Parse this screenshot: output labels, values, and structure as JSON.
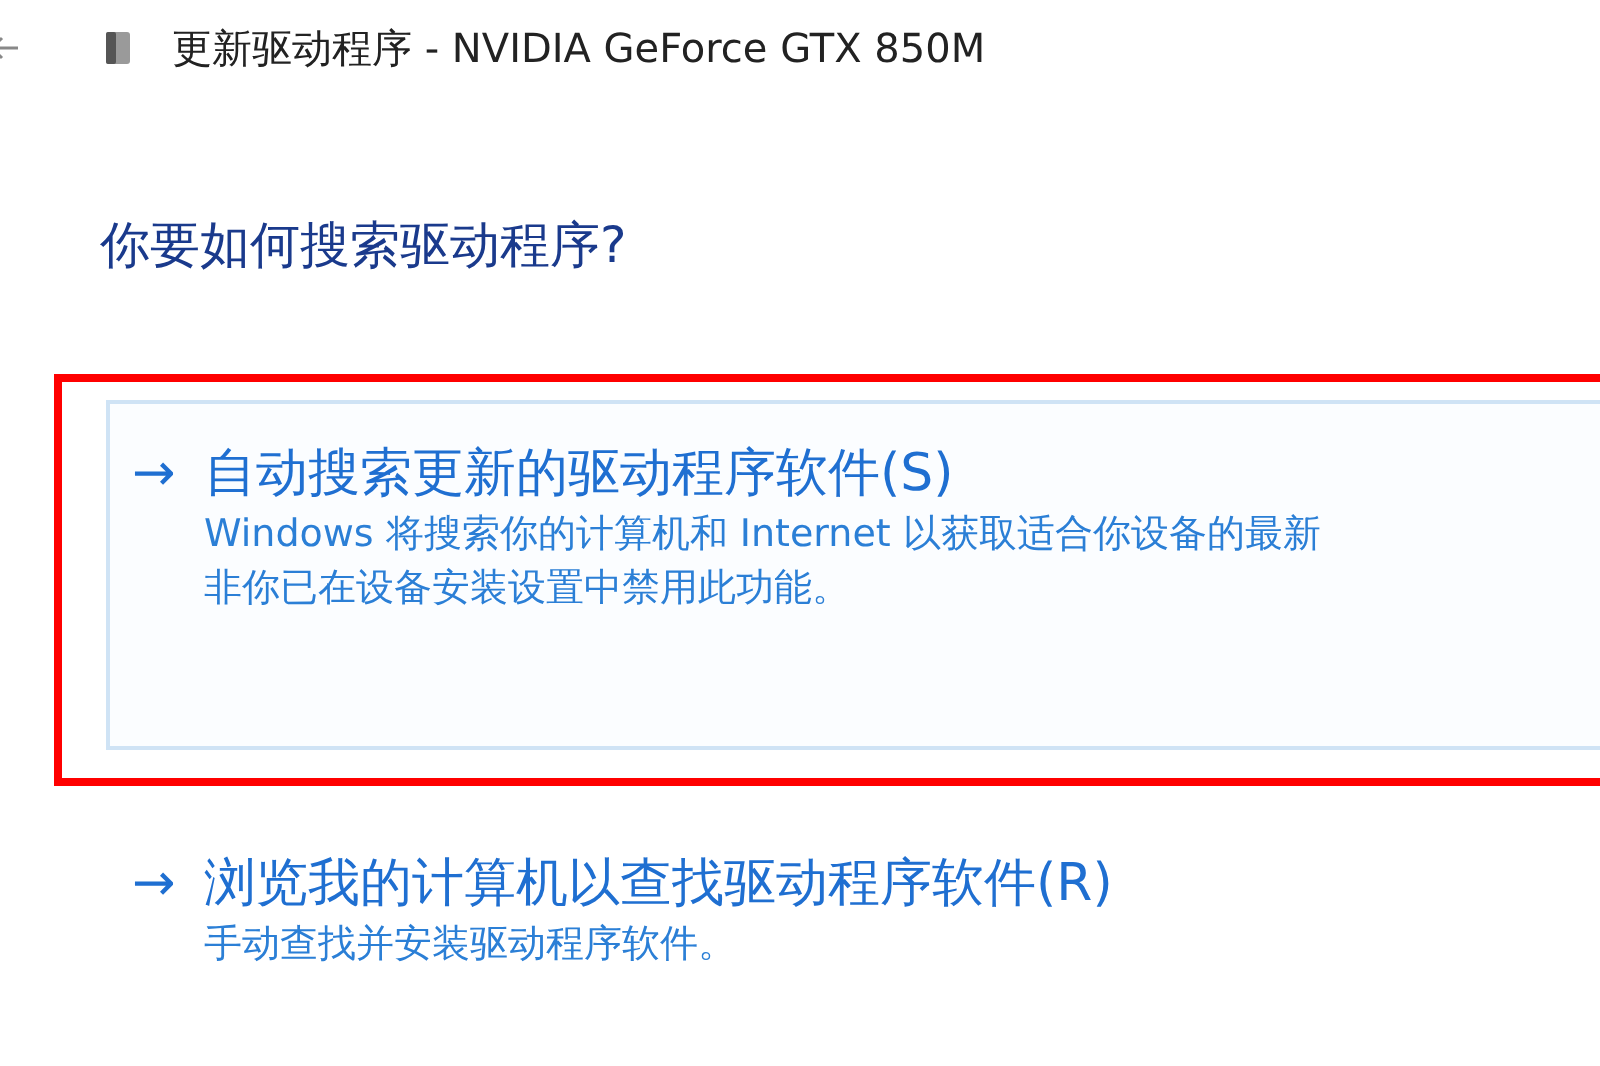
{
  "window": {
    "title": "更新驱动程序 - NVIDIA GeForce GTX 850M"
  },
  "heading": "你要如何搜索驱动程序?",
  "options": [
    {
      "arrow": "→",
      "title": "自动搜索更新的驱动程序软件(S)",
      "description": [
        "Windows 将搜索你的计算机和 Internet 以获取适合你设备的最新",
        "非你已在设备安装设置中禁用此功能。"
      ],
      "selected": true,
      "annotated": true
    },
    {
      "arrow": "→",
      "title": "浏览我的计算机以查找驱动程序软件(R)",
      "description": [
        "手动查找并安装驱动程序软件。"
      ],
      "selected": false,
      "annotated": false
    }
  ]
}
